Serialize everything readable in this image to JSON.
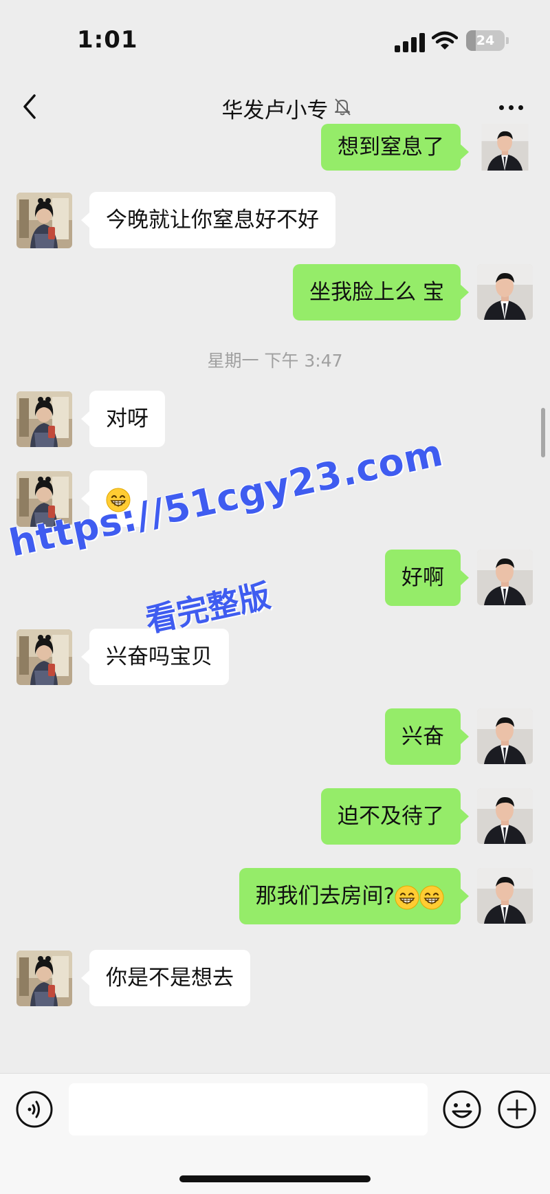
{
  "status_bar": {
    "time": "1:01",
    "battery_level": "24",
    "icons": [
      "cellular-signal-icon",
      "wifi-icon",
      "battery-icon"
    ]
  },
  "nav": {
    "title": "华发卢小专",
    "icons": [
      "back-chevron-icon",
      "muted-bell-icon",
      "more-dots-icon"
    ]
  },
  "messages": [
    {
      "side": "out",
      "text": "想到窒息了"
    },
    {
      "side": "in",
      "text": "今晚就让你窒息好不好"
    },
    {
      "side": "out",
      "text": "坐我脸上么 宝"
    },
    {
      "type": "timestamp",
      "text": "星期一 下午 3:47"
    },
    {
      "side": "in",
      "text": "对呀"
    },
    {
      "side": "in",
      "text": "",
      "emoji": "grinning-face-emoji"
    },
    {
      "side": "out",
      "text": "好啊"
    },
    {
      "side": "in",
      "text": "兴奋吗宝贝"
    },
    {
      "side": "out",
      "text": "兴奋"
    },
    {
      "side": "out",
      "text": "迫不及待了"
    },
    {
      "side": "out",
      "text": "那我们去房间?",
      "emoji": "grinning-face-emoji x2"
    },
    {
      "side": "in",
      "text": "你是不是想去"
    }
  ],
  "watermark": {
    "url": "https://51cgy23.com",
    "subtitle": "看完整版",
    "color": "#3f5cf0"
  },
  "input_bar": {
    "placeholder": "",
    "icons": [
      "voice-input-icon",
      "emoji-icon",
      "plus-icon"
    ]
  },
  "colors": {
    "background": "#ededed",
    "incoming_bubble": "#ffffff",
    "outgoing_bubble": "#95ec69"
  }
}
